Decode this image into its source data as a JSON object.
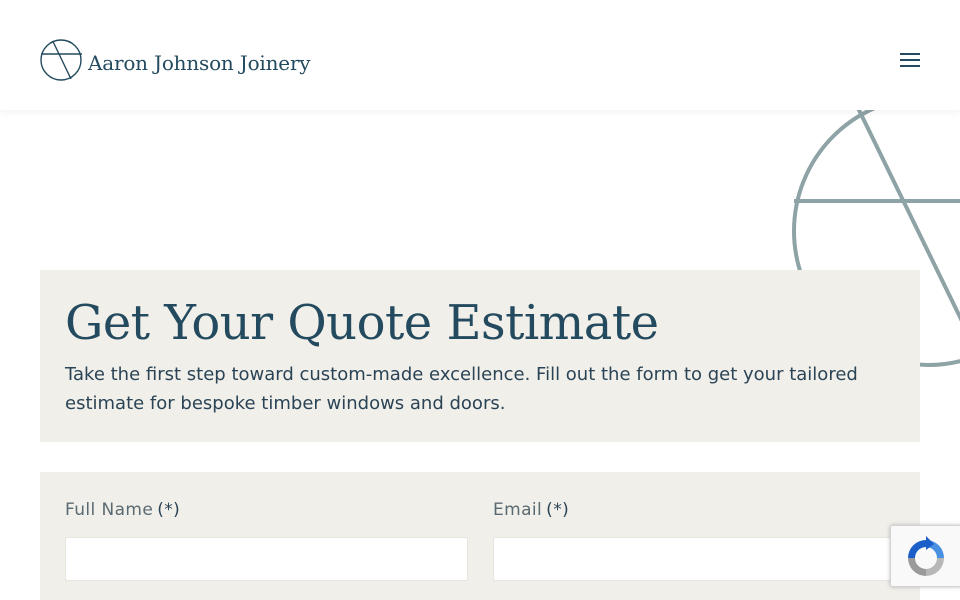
{
  "header": {
    "brand_name": "Aaron Johnson Joinery",
    "logo_icon": "circle-slash-logo",
    "menu_icon": "hamburger-menu-icon"
  },
  "intro": {
    "title": "Get Your Quote Estimate",
    "description": "Take the first step toward custom-made excellence. Fill out the form to get your tailored estimate for bespoke timber windows and doors."
  },
  "form": {
    "full_name": {
      "label": "Full Name",
      "required_marker": "(*)",
      "value": "",
      "placeholder": ""
    },
    "email": {
      "label": "Email",
      "required_marker": "(*)",
      "value": "",
      "placeholder": ""
    }
  },
  "recaptcha": {
    "icon": "recaptcha-icon"
  },
  "colors": {
    "brand": "#234a5e",
    "panel_bg": "#f1efea",
    "decorative_mark": "#8ea3a6"
  }
}
